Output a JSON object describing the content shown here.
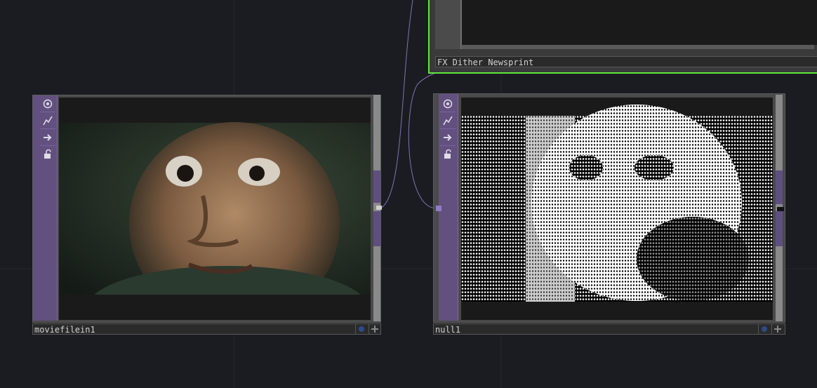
{
  "nodes": {
    "moviefilein": {
      "name": "moviefilein1"
    },
    "null": {
      "name": "null1"
    },
    "fx": {
      "name": "FX_Dither_Newsprint"
    }
  },
  "sidebar_icons": [
    "viewer-toggle-icon",
    "graph-icon",
    "arrow-right-icon",
    "lock-icon"
  ],
  "colors": {
    "background": "#1b1c21",
    "operator_purple": "#62517f",
    "selected_outline": "#5ee83a",
    "wire": "#7d74b8"
  }
}
